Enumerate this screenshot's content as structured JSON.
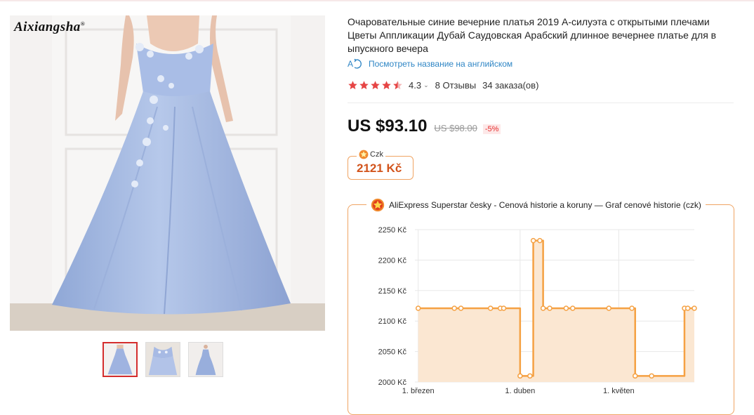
{
  "gallery": {
    "brand": "Aixiangsha",
    "brand_mark": "®",
    "thumbnails": [
      {
        "name": "thumb-front",
        "active": true
      },
      {
        "name": "thumb-detail",
        "active": false
      },
      {
        "name": "thumb-full",
        "active": false
      }
    ]
  },
  "product": {
    "title": "Очаровательные синие вечерние платья 2019 А-силуэта с открытыми плечами Цветы Аппликации Дубай Саудовская Арабский длинное вечернее платье для в ыпускного вечера",
    "translate_link": "Посмотреть название на английском",
    "rating": "4.3",
    "rating_stars": 4.5,
    "rating_chevron": "⌄",
    "reviews": "8 Отзывы",
    "orders": "34 заказа(ов)",
    "price": "US $93.10",
    "old_price": "US $98.00",
    "discount": "-5%",
    "colors": {
      "star": "#e64545",
      "link": "#2f86c5",
      "accent": "#f0a463",
      "czk": "#d2541c"
    }
  },
  "czk": {
    "label": "Czk",
    "value": "2121 Kč"
  },
  "history": {
    "title": "AliExpress Superstar česky - Cenová historie a koruny — Graf cenové historie (czk)"
  },
  "chart_data": {
    "type": "line",
    "step": true,
    "title": "AliExpress Superstar česky - Cenová historie a koruny — Graf cenové historie (czk)",
    "x_ticks": [
      "1. březen",
      "1. duben",
      "1. květen"
    ],
    "y_ticks": [
      "2000 Kč",
      "2050 Kč",
      "2100 Kč",
      "2150 Kč",
      "2200 Kč",
      "2250 Kč"
    ],
    "ylim": [
      2000,
      2250
    ],
    "xlim": [
      -1,
      84
    ],
    "series": [
      {
        "color": "#f5a143",
        "fill": "#fbe7d2",
        "points": [
          {
            "x": 0,
            "y": 2121
          },
          {
            "x": 11,
            "y": 2121
          },
          {
            "x": 13,
            "y": 2121
          },
          {
            "x": 22,
            "y": 2121
          },
          {
            "x": 25,
            "y": 2121
          },
          {
            "x": 26,
            "y": 2121
          },
          {
            "x": 31,
            "y": 2010
          },
          {
            "x": 34,
            "y": 2010
          },
          {
            "x": 35,
            "y": 2232
          },
          {
            "x": 37,
            "y": 2232
          },
          {
            "x": 38,
            "y": 2121
          },
          {
            "x": 40,
            "y": 2121
          },
          {
            "x": 45,
            "y": 2121
          },
          {
            "x": 47,
            "y": 2121
          },
          {
            "x": 58,
            "y": 2121
          },
          {
            "x": 65,
            "y": 2121
          },
          {
            "x": 66,
            "y": 2010
          },
          {
            "x": 71,
            "y": 2010
          },
          {
            "x": 81,
            "y": 2121
          },
          {
            "x": 82,
            "y": 2121
          },
          {
            "x": 84,
            "y": 2121
          }
        ]
      }
    ],
    "grid": true,
    "tick_x_values": [
      0,
      31,
      61
    ]
  }
}
